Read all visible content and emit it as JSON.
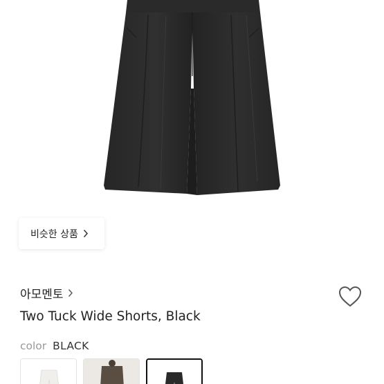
{
  "product": {
    "image_icon": "black-wide-shorts-image",
    "brand": "아모멘토",
    "title": "Two Tuck Wide Shorts, Black"
  },
  "similar": {
    "label": "비슷한 상품"
  },
  "color": {
    "label": "color",
    "value": "BLACK"
  },
  "swatches": [
    {
      "icon": "white-shorts-thumbnail",
      "color": "#f0efec"
    },
    {
      "icon": "brown-shorts-thumbnail",
      "color": "#5a4d42"
    },
    {
      "icon": "black-shorts-thumbnail",
      "color": "#2a2a2a",
      "selected": true
    }
  ],
  "colors": {
    "garment_black": "#2b2b2b",
    "text": "#222222",
    "muted": "#999999"
  }
}
